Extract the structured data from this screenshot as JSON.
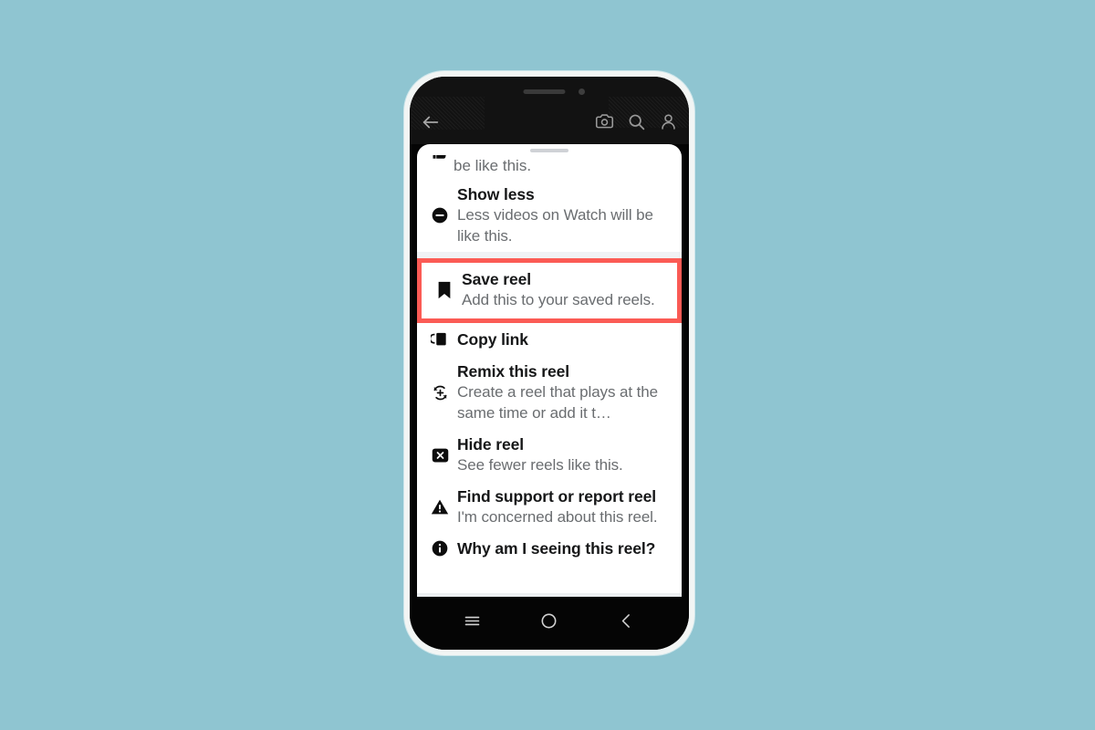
{
  "background": {
    "color": "#8fc5d1"
  },
  "device": {
    "frame_color": "#f2f5f4",
    "bezel_color": "#050505",
    "platform": "android"
  },
  "app_header": {
    "back_icon": "back-arrow-icon",
    "actions": [
      {
        "icon": "camera-icon",
        "name": "camera-button"
      },
      {
        "icon": "search-icon",
        "name": "search-button"
      },
      {
        "icon": "profile-icon",
        "name": "profile-button"
      }
    ]
  },
  "bottom_sheet": {
    "handle": "drag-handle",
    "clipped_top_item": {
      "icon": "thumbs-up-icon",
      "subtitle_fragment": "be like this."
    },
    "items": [
      {
        "id": "show-less",
        "icon": "minus-circle-icon",
        "title": "Show less",
        "subtitle": "Less videos on Watch will be like this.",
        "highlighted": false
      },
      {
        "id": "save-reel",
        "icon": "bookmark-icon",
        "title": "Save reel",
        "subtitle": "Add this to your saved reels.",
        "highlighted": true
      },
      {
        "id": "copy-link",
        "icon": "copy-icon",
        "title": "Copy link",
        "subtitle": "",
        "highlighted": false
      },
      {
        "id": "remix-this-reel",
        "icon": "remix-icon",
        "title": "Remix this reel",
        "subtitle": "Create a reel that plays at the same time or add it t…",
        "highlighted": false
      },
      {
        "id": "hide-reel",
        "icon": "hide-x-icon",
        "title": "Hide reel",
        "subtitle": "See fewer reels like this.",
        "highlighted": false
      },
      {
        "id": "find-support-or-report-reel",
        "icon": "warning-triangle-icon",
        "title": "Find support or report reel",
        "subtitle": "I'm concerned about this reel.",
        "highlighted": false
      },
      {
        "id": "why-am-i-seeing-this-reel",
        "icon": "info-circle-icon",
        "title": "Why am I seeing this reel?",
        "subtitle": "",
        "highlighted": false
      }
    ]
  },
  "highlight": {
    "color": "#fb5b55",
    "target": "save-reel"
  },
  "android_nav": {
    "recents_icon": "menu-lines-icon",
    "home_icon": "circle-icon",
    "back_icon": "chevron-left-icon"
  },
  "colors": {
    "title_text": "#161718",
    "subtitle_text": "#6a6d70",
    "sheet_bg": "#ffffff",
    "divider": "#f0f2f5"
  }
}
